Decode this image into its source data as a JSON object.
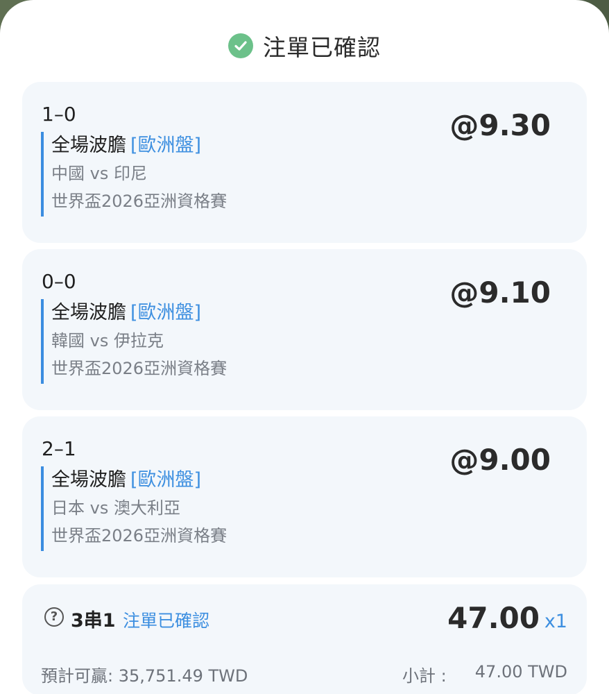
{
  "header": {
    "title": "注單已確認",
    "icon": "check-circle-icon",
    "icon_color": "#6cc18a"
  },
  "bets": [
    {
      "score": "1–0",
      "market": "全場波膽",
      "market_tag": "[歐洲盤]",
      "teams": "中國 vs 印尼",
      "league": "世界盃2026亞洲資格賽",
      "odds": "@9.30"
    },
    {
      "score": "0–0",
      "market": "全場波膽",
      "market_tag": "[歐洲盤]",
      "teams": "韓國 vs 伊拉克",
      "league": "世界盃2026亞洲資格賽",
      "odds": "@9.10"
    },
    {
      "score": "2–1",
      "market": "全場波膽",
      "market_tag": "[歐洲盤]",
      "teams": "日本 vs 澳大利亞",
      "league": "世界盃2026亞洲資格賽",
      "odds": "@9.00"
    }
  ],
  "summary": {
    "help_icon": "question-circle-icon",
    "help_glyph": "?",
    "parlay_type": "3串1",
    "status": "注單已確認",
    "stake": "47.00",
    "multiplier": "x1",
    "potential_win": "預計可贏: 35,751.49 TWD",
    "subtotal_label": "小計 :",
    "subtotal_value": "47.00 TWD"
  },
  "colors": {
    "accent_blue": "#3d8fe0",
    "card_background": "#f3f7fb"
  }
}
